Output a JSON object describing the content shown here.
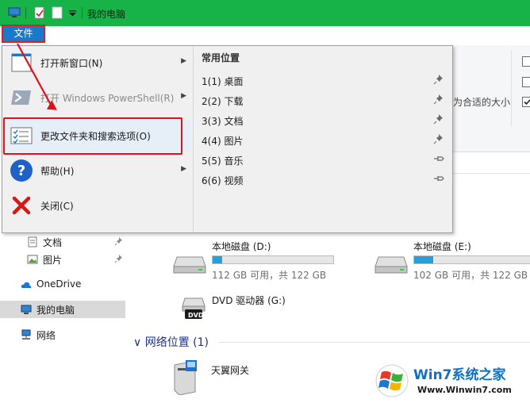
{
  "window": {
    "title": "我的电脑"
  },
  "file_tab": {
    "label": "文件"
  },
  "ribbon": {
    "fit_size_text": "为合适的大小"
  },
  "file_menu": {
    "items": [
      {
        "label": "打开新窗口(N)",
        "has_submenu": true,
        "enabled": true
      },
      {
        "label": "打开 Windows PowerShell(R)",
        "has_submenu": true,
        "enabled": false
      },
      {
        "label": "更改文件夹和搜索选项(O)",
        "has_submenu": false,
        "enabled": true
      },
      {
        "label": "帮助(H)",
        "has_submenu": true,
        "enabled": true
      },
      {
        "label": "关闭(C)",
        "has_submenu": false,
        "enabled": true
      }
    ],
    "recent_title": "常用位置",
    "recent_items": [
      {
        "label": "1(1)  桌面",
        "pinned": true
      },
      {
        "label": "2(2)  下载",
        "pinned": true
      },
      {
        "label": "3(3)  文档",
        "pinned": true
      },
      {
        "label": "4(4)  图片",
        "pinned": true
      },
      {
        "label": "5(5)  音乐",
        "pinned": false
      },
      {
        "label": "6(6)  视频",
        "pinned": false
      }
    ]
  },
  "nav": {
    "items": [
      {
        "label": "文档"
      },
      {
        "label": "图片"
      },
      {
        "label": "OneDrive"
      },
      {
        "label": "我的电脑"
      },
      {
        "label": "网络"
      }
    ]
  },
  "drives": [
    {
      "name": "本地磁盘 (D:)",
      "space": "112 GB 可用，共 122 GB",
      "used_fraction": 0.08
    },
    {
      "name": "本地磁盘 (E:)",
      "space": "102 GB 可用，共 122 GB",
      "used_fraction": 0.16
    },
    {
      "name": "DVD 驱动器 (G:)"
    }
  ],
  "network": {
    "section_label": "网络位置 (1)",
    "item_label": "天翼网关"
  },
  "watermark": {
    "brand": "Win7系统之家",
    "url": "Www.Winwin7.com"
  },
  "colors": {
    "title_bar": "#17b248",
    "file_tab": "#1979ca",
    "highlight": "#d8141c",
    "drive_bar": "#26a0da",
    "link_blue": "#1e3287"
  }
}
